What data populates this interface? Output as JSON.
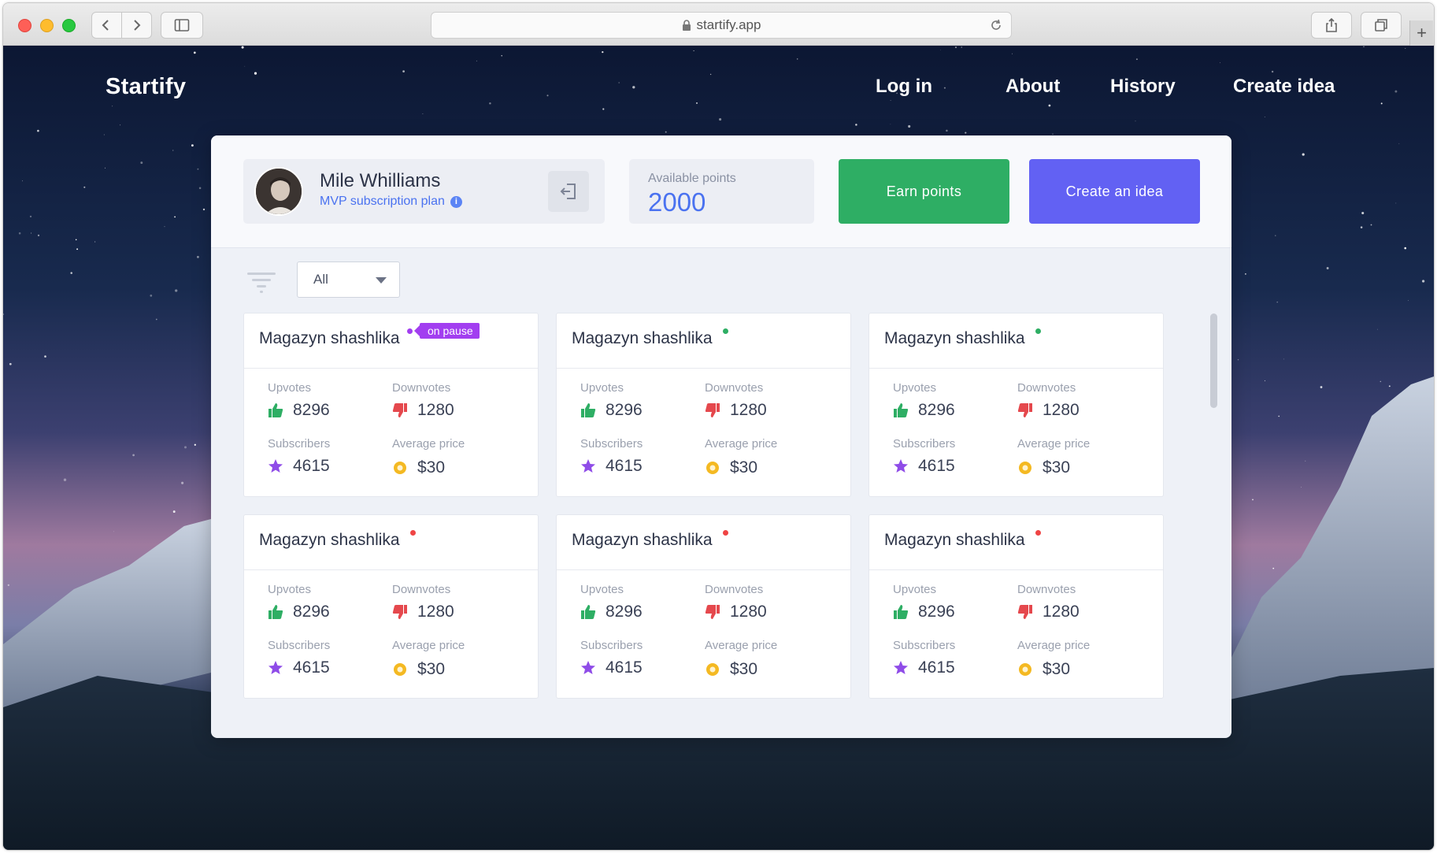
{
  "browser": {
    "url": "startify.app"
  },
  "site": {
    "brand": "Startify",
    "nav": [
      {
        "label": "Log in"
      },
      {
        "label": "About"
      },
      {
        "label": "History"
      },
      {
        "label": "Create idea"
      }
    ]
  },
  "profile": {
    "name": "Mile Whilliams",
    "plan": "MVP subscription plan"
  },
  "points": {
    "label": "Available points",
    "value": "2000"
  },
  "actions": {
    "earn_label": "Earn points",
    "create_label": "Create an idea"
  },
  "filter": {
    "selected": "All"
  },
  "colors": {
    "green": "#2eae64",
    "purple": "#6261f3",
    "status_active": "#2eae64",
    "status_inactive": "#ef4444",
    "status_paused": "#a23ef0"
  },
  "cards": [
    {
      "title": "Magazyn shashlika",
      "status": "paused",
      "badge": "on pause",
      "upvotes_label": "Upvotes",
      "upvotes": "8296",
      "downvotes_label": "Downvotes",
      "downvotes": "1280",
      "subscribers_label": "Subscribers",
      "subscribers": "4615",
      "price_label": "Average price",
      "price": "$30"
    },
    {
      "title": "Magazyn shashlika",
      "status": "active",
      "upvotes_label": "Upvotes",
      "upvotes": "8296",
      "downvotes_label": "Downvotes",
      "downvotes": "1280",
      "subscribers_label": "Subscribers",
      "subscribers": "4615",
      "price_label": "Average price",
      "price": "$30"
    },
    {
      "title": "Magazyn shashlika",
      "status": "active",
      "upvotes_label": "Upvotes",
      "upvotes": "8296",
      "downvotes_label": "Downvotes",
      "downvotes": "1280",
      "subscribers_label": "Subscribers",
      "subscribers": "4615",
      "price_label": "Average price",
      "price": "$30"
    },
    {
      "title": "Magazyn shashlika",
      "status": "inactive",
      "upvotes_label": "Upvotes",
      "upvotes": "8296",
      "downvotes_label": "Downvotes",
      "downvotes": "1280",
      "subscribers_label": "Subscribers",
      "subscribers": "4615",
      "price_label": "Average price",
      "price": "$30"
    },
    {
      "title": "Magazyn shashlika",
      "status": "inactive",
      "upvotes_label": "Upvotes",
      "upvotes": "8296",
      "downvotes_label": "Downvotes",
      "downvotes": "1280",
      "subscribers_label": "Subscribers",
      "subscribers": "4615",
      "price_label": "Average price",
      "price": "$30"
    },
    {
      "title": "Magazyn shashlika",
      "status": "inactive",
      "upvotes_label": "Upvotes",
      "upvotes": "8296",
      "downvotes_label": "Downvotes",
      "downvotes": "1280",
      "subscribers_label": "Subscribers",
      "subscribers": "4615",
      "price_label": "Average price",
      "price": "$30"
    }
  ]
}
